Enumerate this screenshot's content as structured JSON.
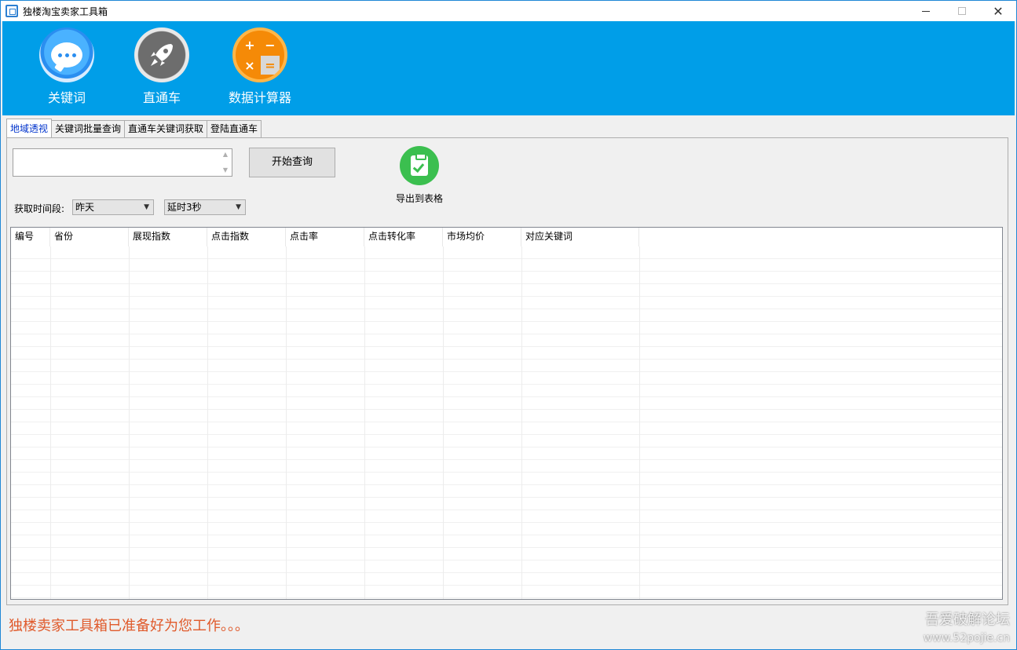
{
  "window": {
    "title": "独楼淘宝卖家工具箱"
  },
  "toolbar": {
    "items": [
      {
        "label": "关键词",
        "icon": "chat-bubble-icon"
      },
      {
        "label": "直通车",
        "icon": "rocket-icon"
      },
      {
        "label": "数据计算器",
        "icon": "calculator-icon"
      }
    ]
  },
  "calculator_symbols": [
    "+",
    "−",
    "×",
    "="
  ],
  "tabs": [
    {
      "label": "地域透视",
      "active": true
    },
    {
      "label": "关键词批量查询",
      "active": false
    },
    {
      "label": "直通车关键词获取",
      "active": false
    },
    {
      "label": "登陆直通车",
      "active": false
    }
  ],
  "query": {
    "value": "",
    "start_label": "开始查询"
  },
  "export": {
    "label": "导出到表格"
  },
  "period": {
    "label": "获取时间段:",
    "selected": "昨天"
  },
  "delay": {
    "selected": "延时3秒"
  },
  "table": {
    "columns": [
      "编号",
      "省份",
      "展现指数",
      "点击指数",
      "点击率",
      "点击转化率",
      "市场均价",
      "对应关键词"
    ],
    "rows": []
  },
  "status": {
    "message": "独楼卖家工具箱已准备好为您工作。。。"
  },
  "watermark": {
    "line1": "吾爱破解论坛",
    "line2": "www.52pojie.cn"
  },
  "colors": {
    "toolbar": "#009ee8",
    "status": "#e05a2b",
    "export_green": "#3bbf4f",
    "calc_orange": "#f58a07"
  }
}
